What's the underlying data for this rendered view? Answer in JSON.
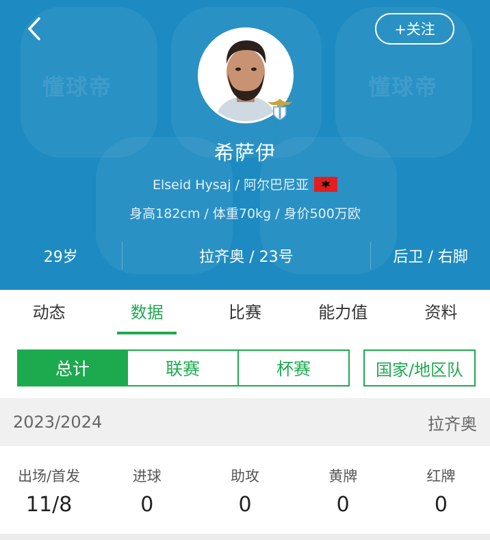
{
  "header": {
    "follow_label": "+关注",
    "watermark": "懂球帝",
    "player_name": "希萨伊",
    "name_country": "Elseid Hysaj / 阿尔巴尼亚",
    "body_info": "身高182cm / 体重70kg / 身价500万欧",
    "age": "29岁",
    "club_number": "拉齐奥 / 23号",
    "position_foot": "后卫 / 右脚"
  },
  "tabs": [
    "动态",
    "数据",
    "比赛",
    "能力值",
    "资料"
  ],
  "segments": [
    "总计",
    "联赛",
    "杯赛",
    "国家/地区队"
  ],
  "season": {
    "label": "2023/2024",
    "team": "拉齐奥"
  },
  "stats": [
    {
      "label": "出场/首发",
      "value": "11/8"
    },
    {
      "label": "进球",
      "value": "0"
    },
    {
      "label": "助攻",
      "value": "0"
    },
    {
      "label": "黄牌",
      "value": "0"
    },
    {
      "label": "红牌",
      "value": "0"
    }
  ],
  "colors": {
    "header_bg": "#1d8bc1",
    "accent_green": "#1daa4f",
    "flag_red": "#e41e20"
  },
  "icons": [
    "back-arrow-icon",
    "player-photo",
    "lazio-badge-icon",
    "albania-flag-icon"
  ]
}
